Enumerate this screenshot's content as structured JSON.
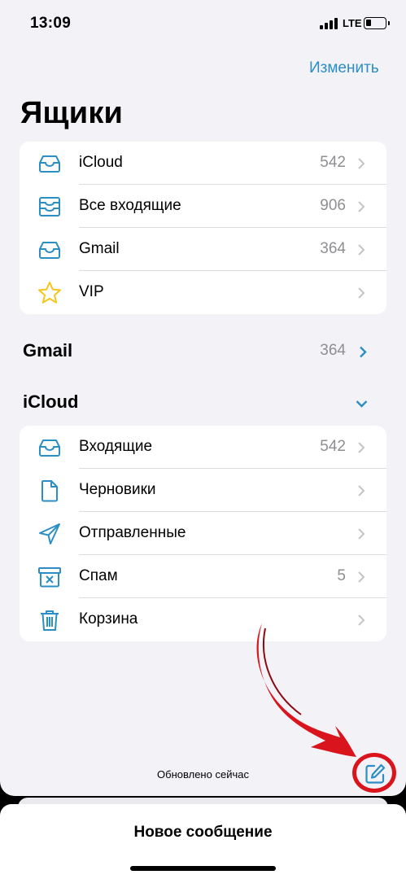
{
  "status": {
    "time": "13:09",
    "network": "LTE"
  },
  "header": {
    "edit_label": "Изменить",
    "title": "Ящики"
  },
  "mailboxes": [
    {
      "label": "iCloud",
      "count": "542",
      "icon": "inbox-icon"
    },
    {
      "label": "Все входящие",
      "count": "906",
      "icon": "all-inboxes-icon"
    },
    {
      "label": "Gmail",
      "count": "364",
      "icon": "inbox-icon"
    },
    {
      "label": "VIP",
      "count": "",
      "icon": "star-icon"
    }
  ],
  "gmail_section": {
    "title": "Gmail",
    "count": "364"
  },
  "icloud_section": {
    "title": "iCloud",
    "items": [
      {
        "label": "Входящие",
        "count": "542",
        "icon": "inbox-icon"
      },
      {
        "label": "Черновики",
        "count": "",
        "icon": "document-icon"
      },
      {
        "label": "Отправленные",
        "count": "",
        "icon": "paper-plane-icon"
      },
      {
        "label": "Спам",
        "count": "5",
        "icon": "junk-box-icon"
      },
      {
        "label": "Корзина",
        "count": "",
        "icon": "trash-icon"
      }
    ]
  },
  "footer": {
    "updated": "Обновлено сейчас"
  },
  "sheet": {
    "title": "Новое сообщение"
  },
  "colors": {
    "accent": "#2b8ec4",
    "background": "#f2f2f7",
    "annotation_red": "#d9141c",
    "star_yellow": "#f5c518"
  }
}
